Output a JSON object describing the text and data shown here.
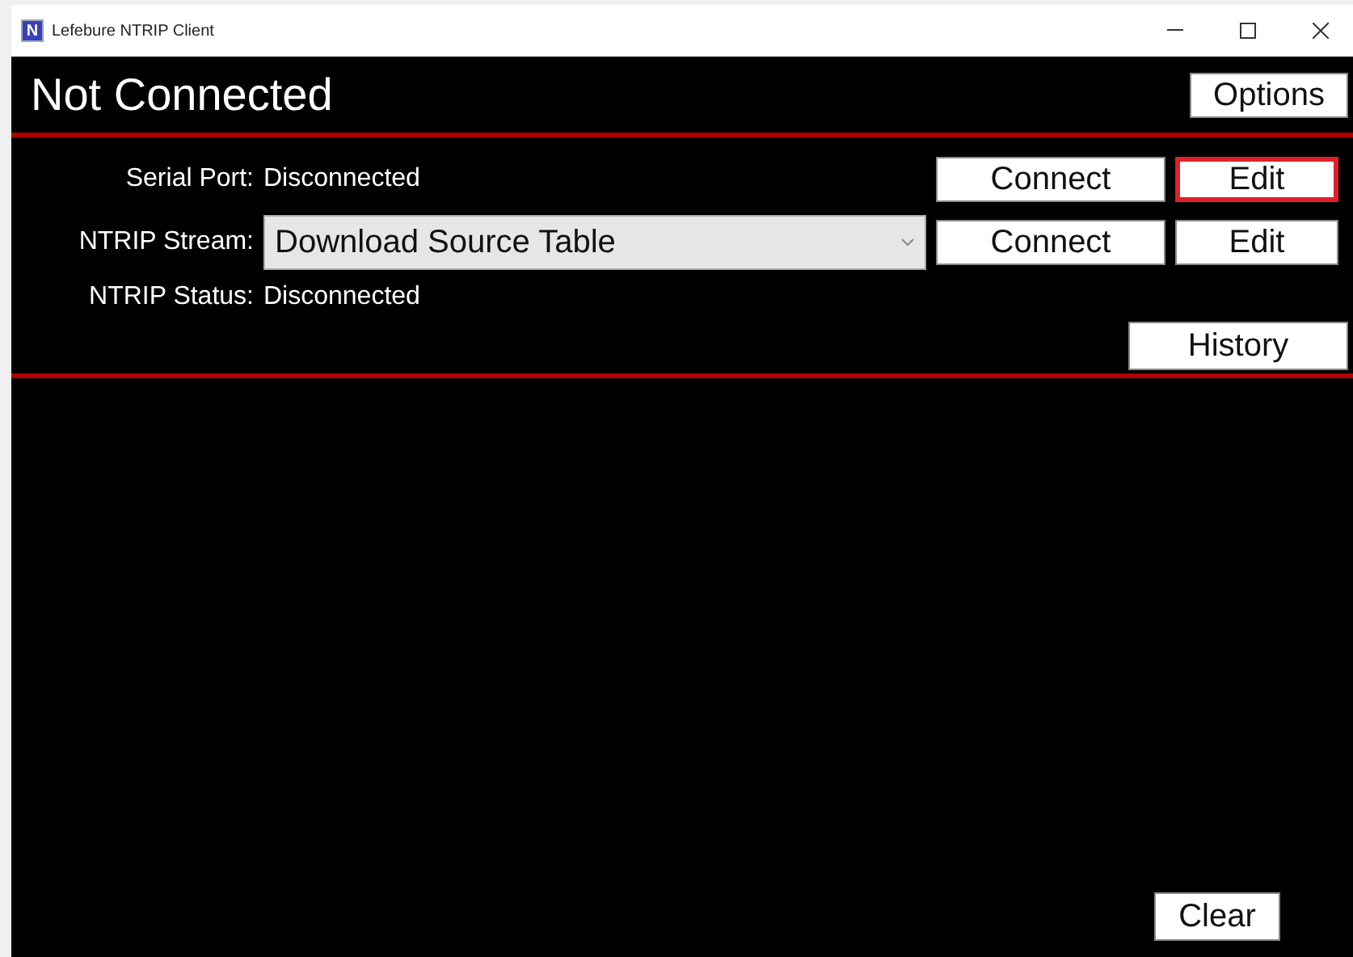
{
  "window": {
    "title": "Lefebure NTRIP Client",
    "icon": "N"
  },
  "header": {
    "status": "Not Connected",
    "options_button": "Options"
  },
  "rows": [
    {
      "label": "Serial Port:",
      "kind": "text",
      "value": "Disconnected",
      "buttons": [
        {
          "label": "Connect",
          "focused": false
        },
        {
          "label": "Edit",
          "focused": true
        }
      ]
    },
    {
      "label": "NTRIP Stream:",
      "kind": "dropdown",
      "value": "Download Source Table",
      "buttons": [
        {
          "label": "Connect",
          "focused": false
        },
        {
          "label": "Edit",
          "focused": false
        }
      ]
    },
    {
      "label": "NTRIP Status:",
      "kind": "text",
      "value": "Disconnected",
      "buttons": []
    }
  ],
  "history_button": "History",
  "clear_button": "Clear"
}
